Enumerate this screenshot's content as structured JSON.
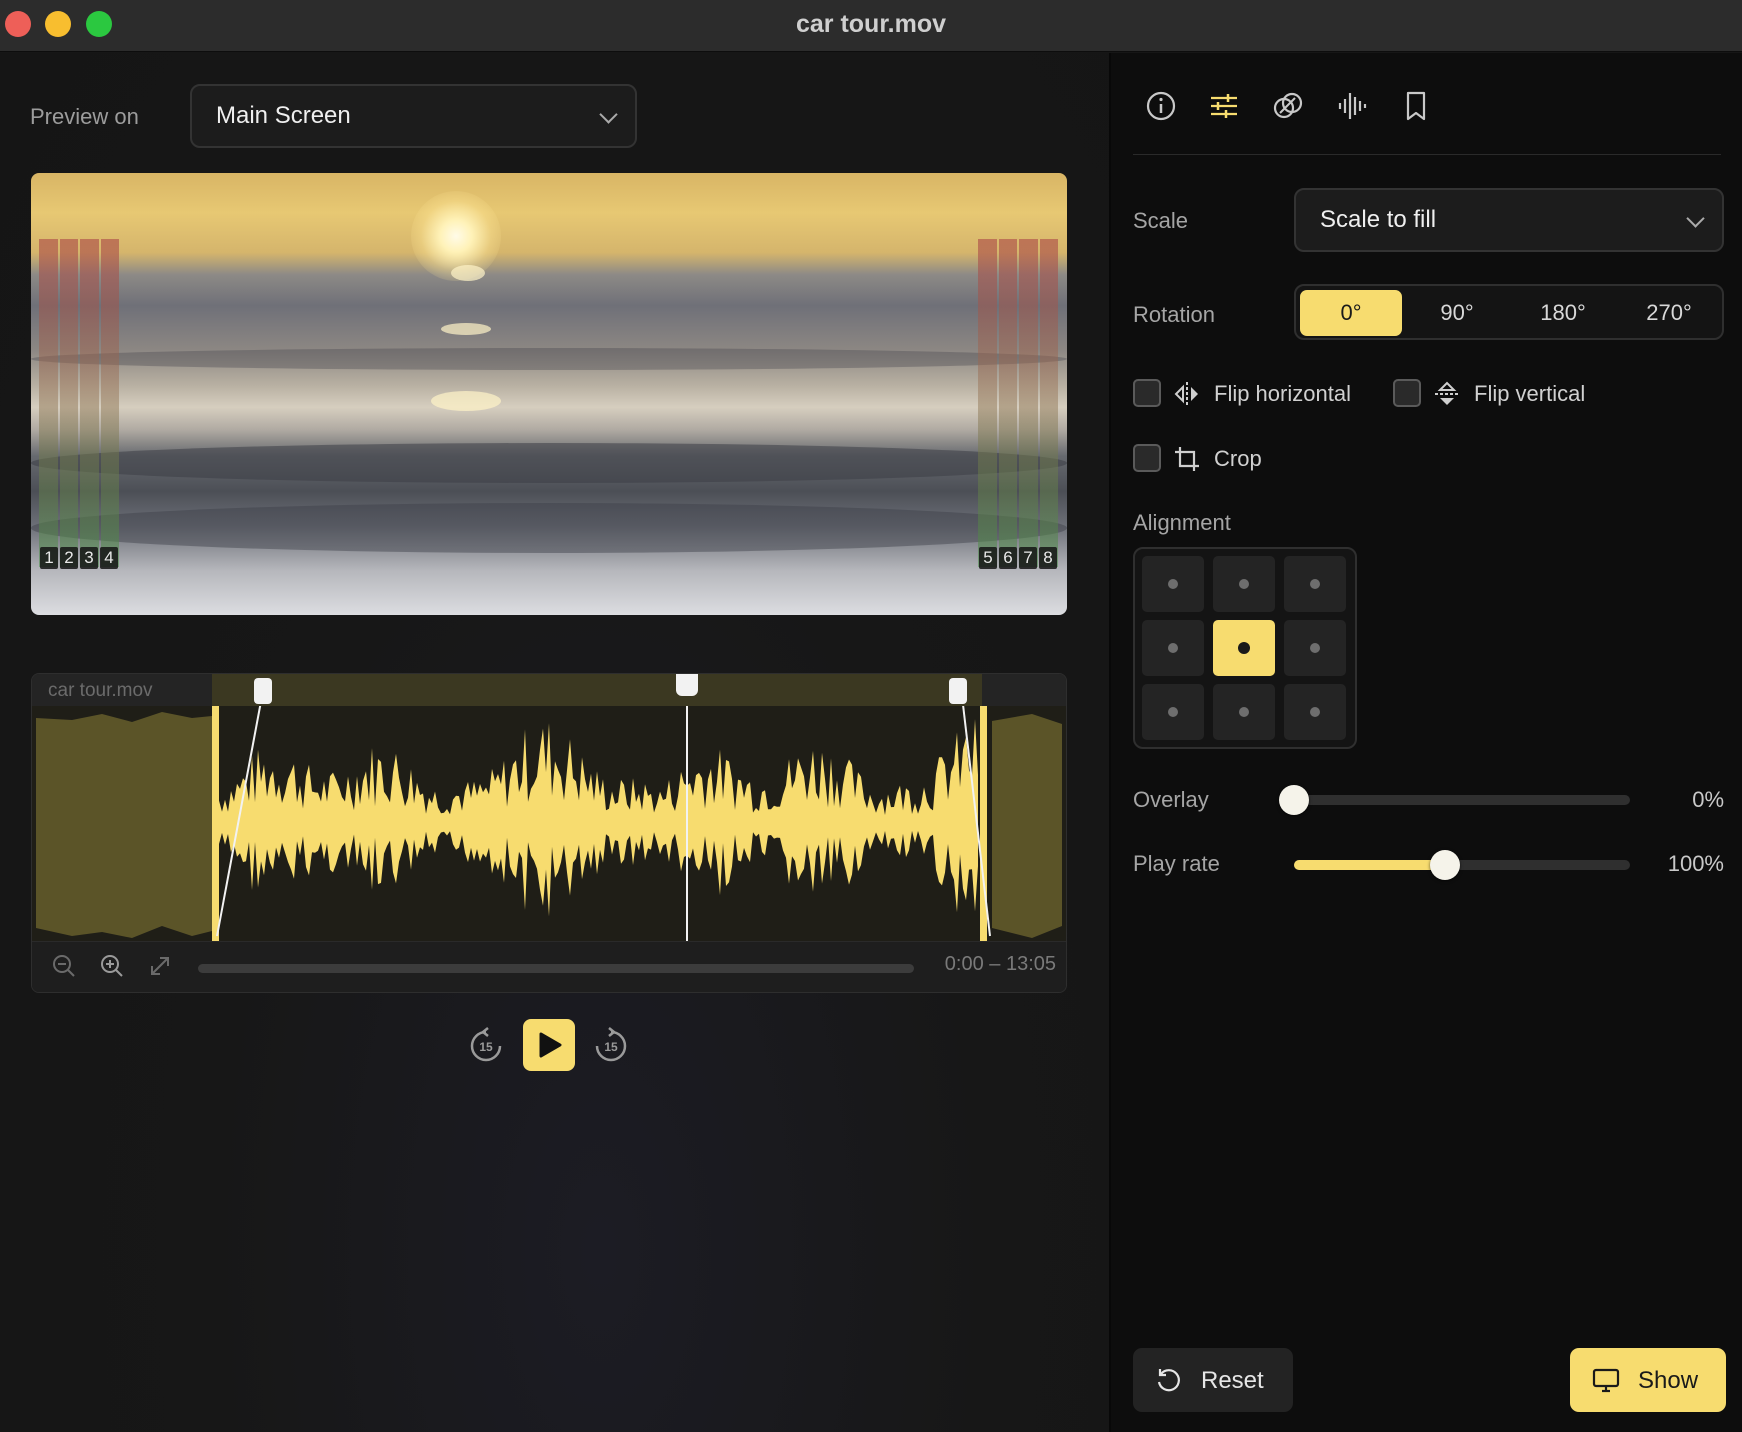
{
  "window": {
    "title": "car tour.mov"
  },
  "preview": {
    "label": "Preview on",
    "selected": "Main Screen",
    "meter_left_channels": [
      "1",
      "2",
      "3",
      "4"
    ],
    "meter_right_channels": [
      "5",
      "6",
      "7",
      "8"
    ]
  },
  "timeline": {
    "clip_name": "car tour.mov",
    "time_range": "0:00 – 13:05",
    "icons": [
      "zoom-out-icon",
      "zoom-in-icon",
      "expand-icon"
    ]
  },
  "transport": {
    "skip_back_label": "15",
    "skip_forward_label": "15",
    "icons": [
      "skip-back-15-icon",
      "play-icon",
      "skip-forward-15-icon"
    ]
  },
  "inspector": {
    "toolbar_icons": [
      "info-icon",
      "sliders-icon",
      "overlap-circles-icon",
      "waveform-icon",
      "bookmark-icon"
    ],
    "scale": {
      "label": "Scale",
      "selected": "Scale to fill"
    },
    "rotation": {
      "label": "Rotation",
      "options": [
        "0°",
        "90°",
        "180°",
        "270°"
      ],
      "selected": "0°"
    },
    "flip_horizontal": {
      "label": "Flip horizontal",
      "checked": false
    },
    "flip_vertical": {
      "label": "Flip vertical",
      "checked": false
    },
    "crop": {
      "label": "Crop",
      "checked": false
    },
    "alignment": {
      "label": "Alignment",
      "selected": "center"
    },
    "overlay": {
      "label": "Overlay",
      "value": "0%",
      "fraction": 0.0
    },
    "play_rate": {
      "label": "Play rate",
      "value": "100%",
      "fraction": 0.45
    },
    "reset_label": "Reset",
    "show_label": "Show"
  },
  "colors": {
    "accent": "#f7dc6f",
    "panel": "#0d0d0d",
    "background": "#161616"
  }
}
